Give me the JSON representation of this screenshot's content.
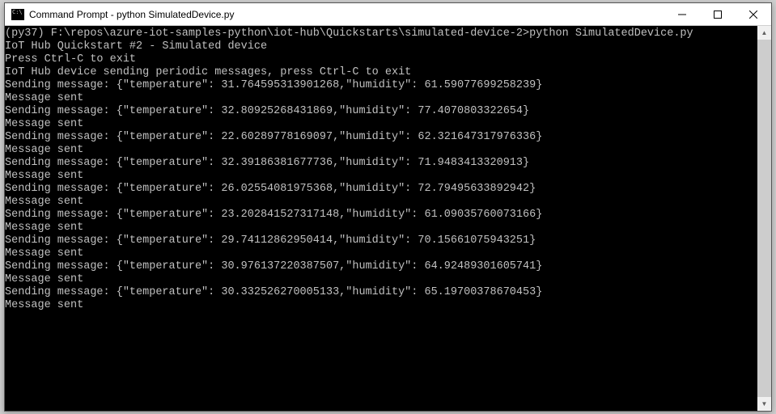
{
  "window": {
    "title": "Command Prompt - python  SimulatedDevice.py"
  },
  "terminal": {
    "prompt_line": "(py37) F:\\repos\\azure-iot-samples-python\\iot-hub\\Quickstarts\\simulated-device-2>python SimulatedDevice.py",
    "header1": "IoT Hub Quickstart #2 - Simulated device",
    "header2": "Press Ctrl-C to exit",
    "header3": "IoT Hub device sending periodic messages, press Ctrl-C to exit",
    "msg_sent": "Message sent",
    "sending_prefix": "Sending message: ",
    "messages": [
      {
        "temperature": "31.764595313901268",
        "humidity": "61.59077699258239"
      },
      {
        "temperature": "32.80925268431869",
        "humidity": "77.4070803322654"
      },
      {
        "temperature": "22.60289778169097",
        "humidity": "62.321647317976336"
      },
      {
        "temperature": "32.39186381677736",
        "humidity": "71.9483413320913"
      },
      {
        "temperature": "26.02554081975368",
        "humidity": "72.79495633892942"
      },
      {
        "temperature": "23.202841527317148",
        "humidity": "61.09035760073166"
      },
      {
        "temperature": "29.74112862950414",
        "humidity": "70.15661075943251"
      },
      {
        "temperature": "30.976137220387507",
        "humidity": "64.92489301605741"
      },
      {
        "temperature": "30.332526270005133",
        "humidity": "65.19700378670453"
      }
    ]
  }
}
